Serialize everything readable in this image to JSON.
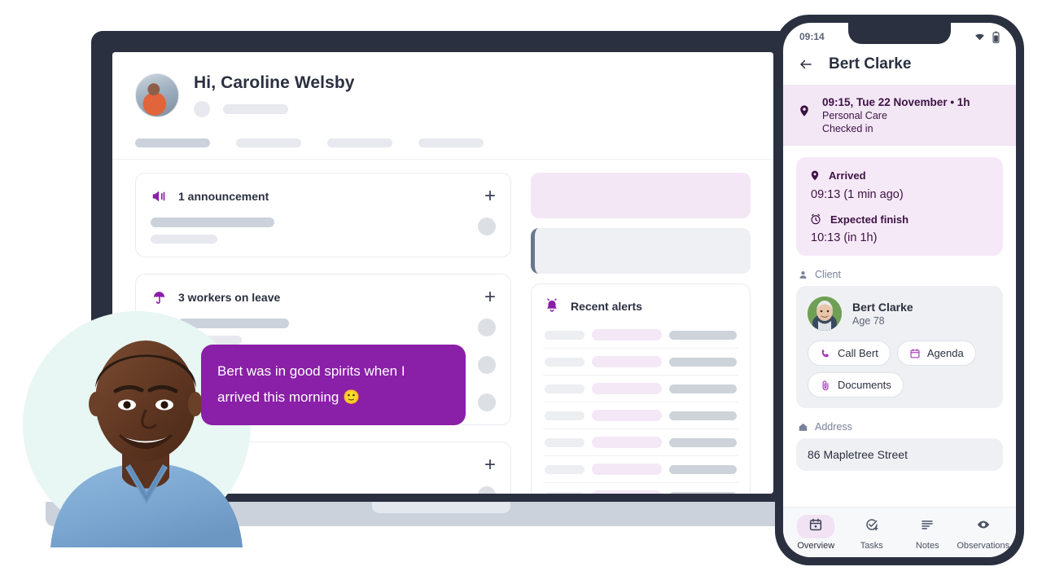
{
  "laptop": {
    "dashboard": {
      "greeting": "Hi, Caroline Welsby",
      "user_avatar": "user-photo",
      "announcements_card": {
        "icon": "megaphone-icon",
        "title": "1 announcement",
        "add_label": "+"
      },
      "leave_card": {
        "icon": "umbrella-icon",
        "title": "3 workers on leave",
        "add_label": "+"
      },
      "third_card": {
        "add_label": "+"
      },
      "alerts_card": {
        "icon": "bell-icon",
        "title": "Recent alerts",
        "row_count": 7
      },
      "nav_tab_count": 4
    }
  },
  "speech_bubble": {
    "text": "Bert was in good spirits when I arrived this morning 🙂"
  },
  "phone": {
    "status": {
      "time": "09:14",
      "wifi_icon": "wifi-icon",
      "battery_icon": "battery-icon"
    },
    "header": {
      "back_icon": "back-arrow-icon",
      "title": "Bert Clarke"
    },
    "visit_banner": {
      "icon": "location-pin-icon",
      "when": "09:15, Tue 22 November • 1h",
      "type": "Personal Care",
      "status": "Checked in"
    },
    "arrival_card": {
      "arrived_icon": "location-pin-icon",
      "arrived_label": "Arrived",
      "arrived_value": "09:13 (1 min ago)",
      "finish_icon": "alarm-clock-icon",
      "finish_label": "Expected finish",
      "finish_value": "10:13 (in 1h)"
    },
    "client_section": {
      "icon": "person-icon",
      "label": "Client",
      "name": "Bert Clarke",
      "age": "Age 78",
      "avatar": "client-photo",
      "buttons": [
        {
          "icon": "phone-icon",
          "label": "Call Bert"
        },
        {
          "icon": "calendar-icon",
          "label": "Agenda"
        },
        {
          "icon": "paperclip-icon",
          "label": "Documents"
        }
      ]
    },
    "address_section": {
      "icon": "home-icon",
      "label": "Address",
      "value": "86 Mapletree Street"
    },
    "bottom_nav": [
      {
        "icon": "calendar-icon",
        "label": "Overview",
        "active": true
      },
      {
        "icon": "task-check-icon",
        "label": "Tasks",
        "active": false
      },
      {
        "icon": "notes-lines-icon",
        "label": "Notes",
        "active": false
      },
      {
        "icon": "eye-icon",
        "label": "Observations",
        "active": false
      }
    ]
  },
  "colors": {
    "brand_purple": "#8a1fa8",
    "deep_plum": "#3d1244",
    "dark_slate": "#2b3040",
    "lavender_bg": "#f3e7f5",
    "mint_circle": "#e8f6f4"
  }
}
